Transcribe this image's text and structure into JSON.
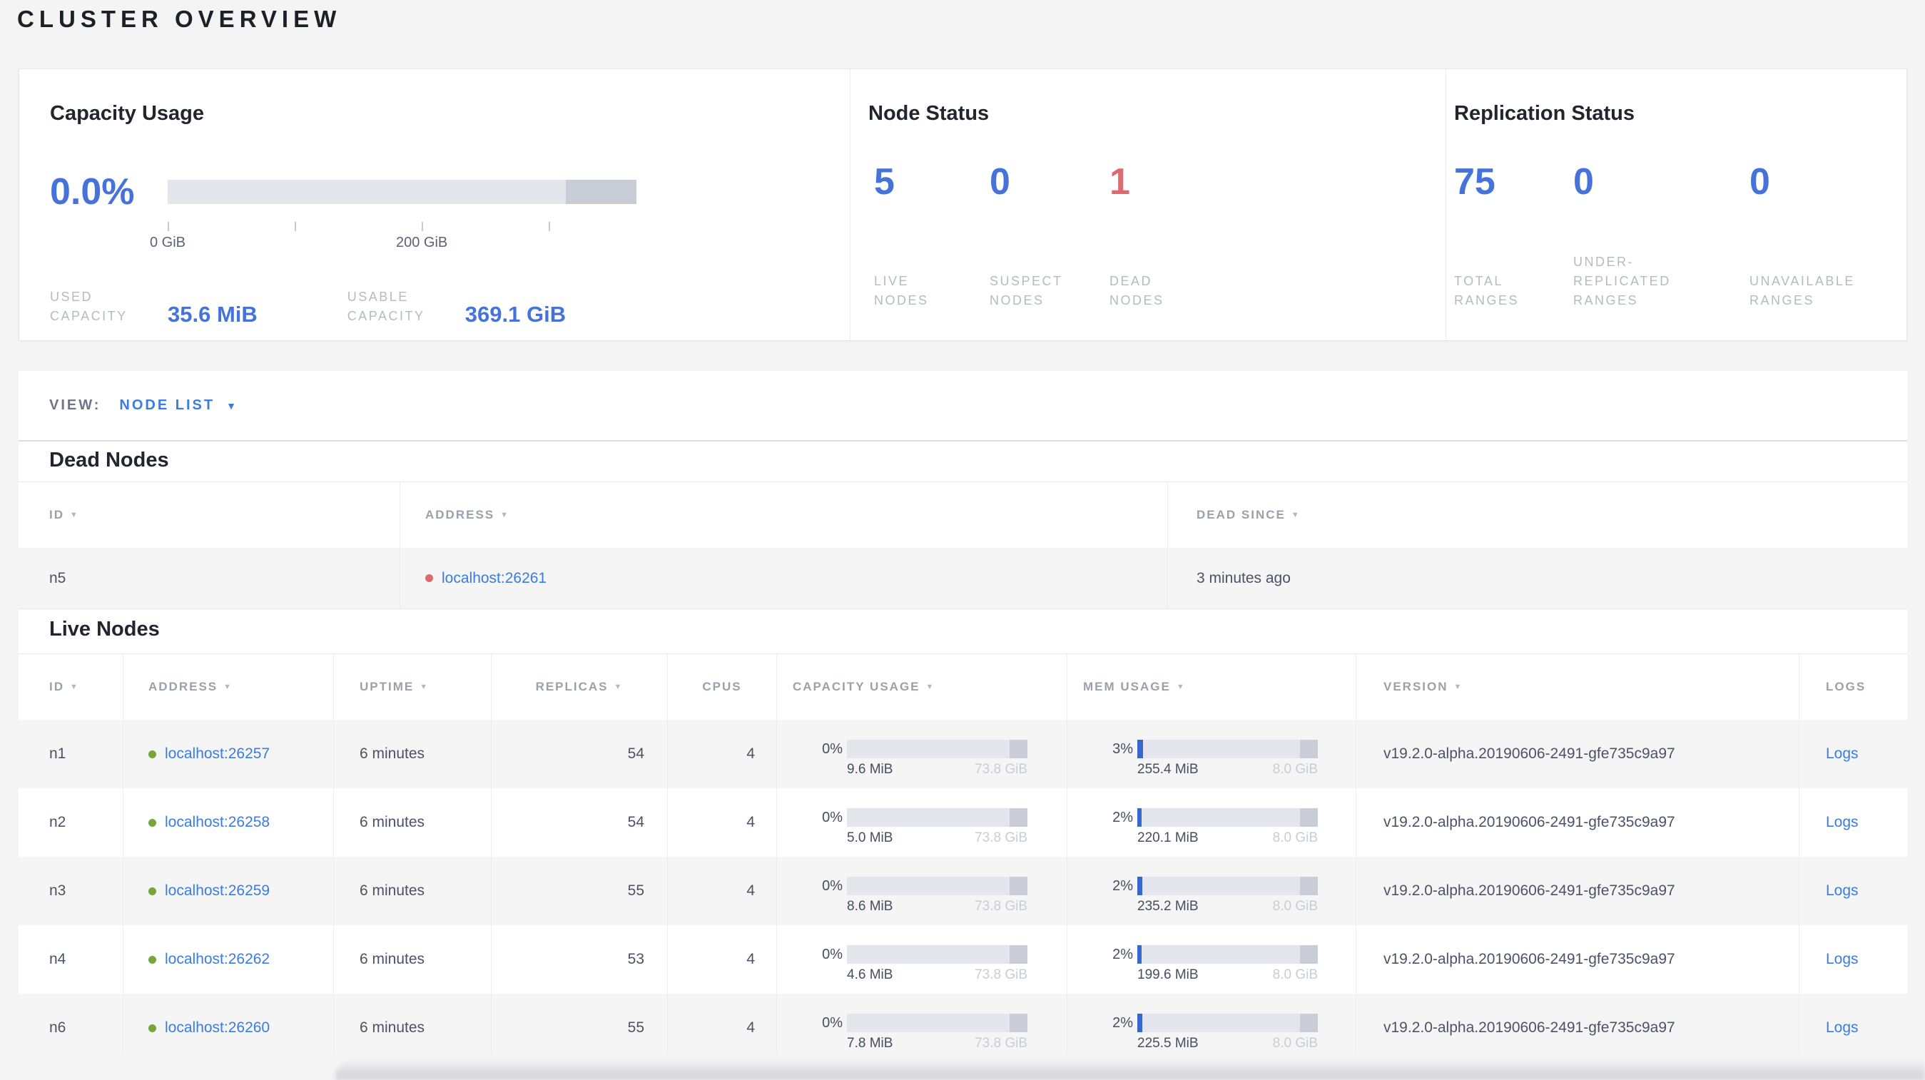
{
  "page_title": "CLUSTER OVERVIEW",
  "colors": {
    "accent_blue": "#4573d9",
    "link_blue": "#3a7ce0",
    "alert_red": "#e0696e",
    "live_dot_green": "#78a53d",
    "dead_dot_red": "#d96c6e",
    "bar_track": "#e3e6ed",
    "bar_cap": "#c9cdd7",
    "bar_fill_blue": "#3a66d2"
  },
  "summary": {
    "capacity": {
      "title": "Capacity Usage",
      "percent": "0.0%",
      "ticks": [
        "0 GiB",
        "200 GiB"
      ],
      "used": {
        "label": "USED\nCAPACITY",
        "value": "35.6 MiB"
      },
      "usable": {
        "label": "USABLE\nCAPACITY",
        "value": "369.1 GiB"
      }
    },
    "node_status": {
      "title": "Node Status",
      "stats": [
        {
          "value": "5",
          "label": "LIVE\nNODES",
          "tone": "blue"
        },
        {
          "value": "0",
          "label": "SUSPECT\nNODES",
          "tone": "blue"
        },
        {
          "value": "1",
          "label": "DEAD\nNODES",
          "tone": "red"
        }
      ]
    },
    "replication": {
      "title": "Replication Status",
      "stats": [
        {
          "value": "75",
          "label": "TOTAL\nRANGES",
          "tone": "blue"
        },
        {
          "value": "0",
          "label": "UNDER-\nREPLICATED\nRANGES",
          "tone": "blue"
        },
        {
          "value": "0",
          "label": "UNAVAILABLE\nRANGES",
          "tone": "blue"
        }
      ]
    }
  },
  "view_bar": {
    "label": "VIEW:",
    "selected": "NODE LIST",
    "caret": "▼"
  },
  "dead_nodes": {
    "heading": "Dead Nodes",
    "sort_glyph": "▼",
    "columns": [
      {
        "label": "ID",
        "sortable": true
      },
      {
        "label": "ADDRESS",
        "sortable": true
      },
      {
        "label": "DEAD SINCE",
        "sortable": true
      }
    ],
    "rows": [
      {
        "id": "n5",
        "address": "localhost:26261",
        "dead_since": "3 minutes ago"
      }
    ]
  },
  "live_nodes": {
    "heading": "Live Nodes",
    "sort_glyph": "▼",
    "columns": [
      {
        "label": "ID",
        "sortable": true
      },
      {
        "label": "ADDRESS",
        "sortable": true
      },
      {
        "label": "UPTIME",
        "sortable": true
      },
      {
        "label": "REPLICAS",
        "sortable": true
      },
      {
        "label": "CPUS",
        "sortable": false
      },
      {
        "label": "CAPACITY USAGE",
        "sortable": true
      },
      {
        "label": "MEM USAGE",
        "sortable": true
      },
      {
        "label": "VERSION",
        "sortable": true
      },
      {
        "label": "LOGS",
        "sortable": false
      }
    ],
    "rows": [
      {
        "id": "n1",
        "address": "localhost:26257",
        "uptime": "6 minutes",
        "replicas": "54",
        "cpus": "4",
        "capacity": {
          "percent": "0%",
          "fill_pct": 0,
          "used": "9.6 MiB",
          "total": "73.8 GiB"
        },
        "memory": {
          "percent": "3%",
          "fill_pct": 3,
          "used": "255.4 MiB",
          "total": "8.0 GiB"
        },
        "version": "v19.2.0-alpha.20190606-2491-gfe735c9a97",
        "logs_label": "Logs"
      },
      {
        "id": "n2",
        "address": "localhost:26258",
        "uptime": "6 minutes",
        "replicas": "54",
        "cpus": "4",
        "capacity": {
          "percent": "0%",
          "fill_pct": 0,
          "used": "5.0 MiB",
          "total": "73.8 GiB"
        },
        "memory": {
          "percent": "2%",
          "fill_pct": 2.5,
          "used": "220.1 MiB",
          "total": "8.0 GiB"
        },
        "version": "v19.2.0-alpha.20190606-2491-gfe735c9a97",
        "logs_label": "Logs"
      },
      {
        "id": "n3",
        "address": "localhost:26259",
        "uptime": "6 minutes",
        "replicas": "55",
        "cpus": "4",
        "capacity": {
          "percent": "0%",
          "fill_pct": 0,
          "used": "8.6 MiB",
          "total": "73.8 GiB"
        },
        "memory": {
          "percent": "2%",
          "fill_pct": 2.7,
          "used": "235.2 MiB",
          "total": "8.0 GiB"
        },
        "version": "v19.2.0-alpha.20190606-2491-gfe735c9a97",
        "logs_label": "Logs"
      },
      {
        "id": "n4",
        "address": "localhost:26262",
        "uptime": "6 minutes",
        "replicas": "53",
        "cpus": "4",
        "capacity": {
          "percent": "0%",
          "fill_pct": 0,
          "used": "4.6 MiB",
          "total": "73.8 GiB"
        },
        "memory": {
          "percent": "2%",
          "fill_pct": 2.3,
          "used": "199.6 MiB",
          "total": "8.0 GiB"
        },
        "version": "v19.2.0-alpha.20190606-2491-gfe735c9a97",
        "logs_label": "Logs"
      },
      {
        "id": "n6",
        "address": "localhost:26260",
        "uptime": "6 minutes",
        "replicas": "55",
        "cpus": "4",
        "capacity": {
          "percent": "0%",
          "fill_pct": 0,
          "used": "7.8 MiB",
          "total": "73.8 GiB"
        },
        "memory": {
          "percent": "2%",
          "fill_pct": 2.6,
          "used": "225.5 MiB",
          "total": "8.0 GiB"
        },
        "version": "v19.2.0-alpha.20190606-2491-gfe735c9a97",
        "logs_label": "Logs"
      }
    ]
  }
}
